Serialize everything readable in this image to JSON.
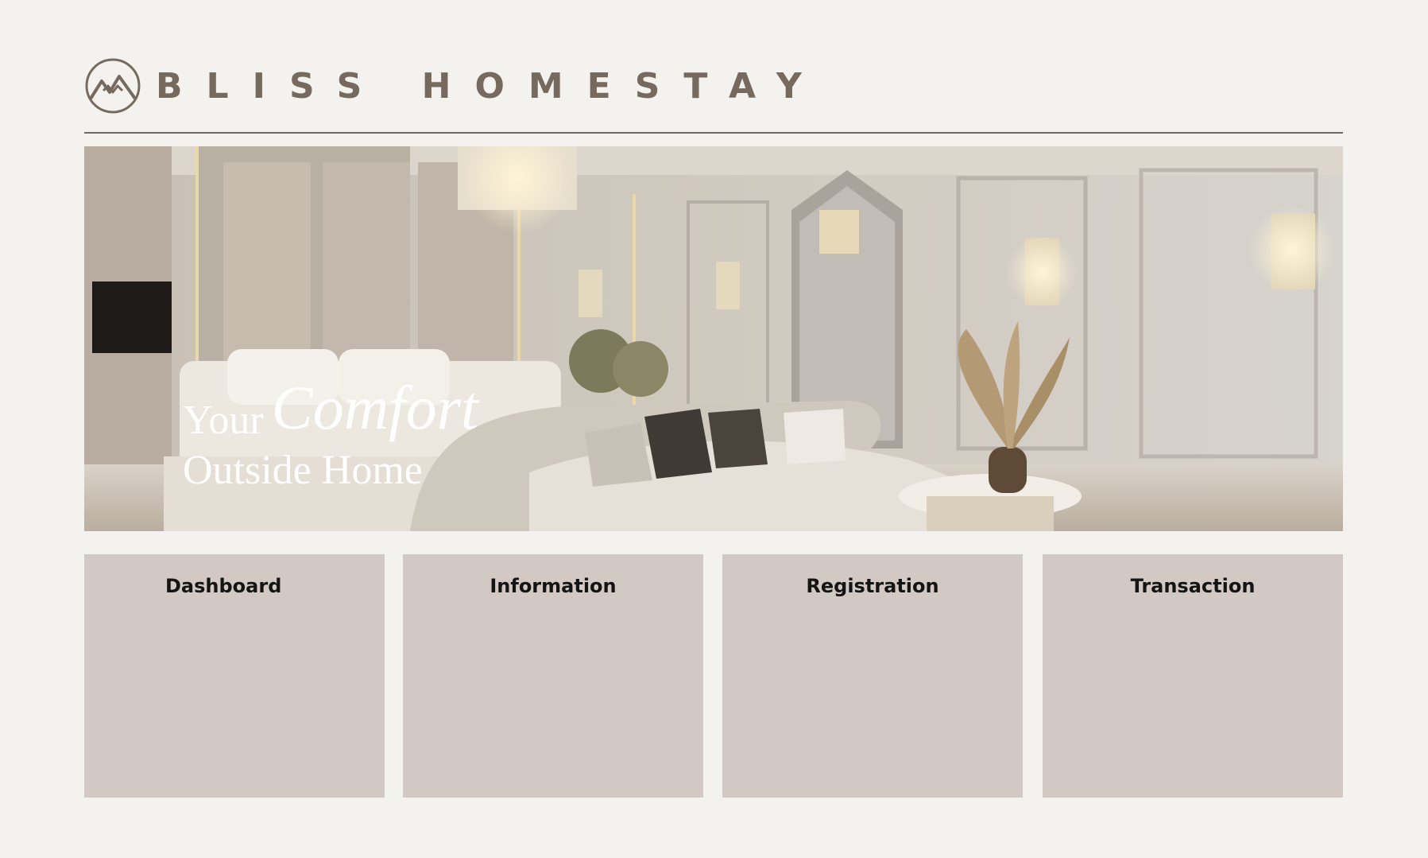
{
  "brand": {
    "name": "BLISS HOMESTAY",
    "logo_icon": "mountain-circle-icon",
    "color": "#756a5d"
  },
  "hero": {
    "image": "luxury-bedroom-photo",
    "tagline_word1": "Your",
    "tagline_word2": "Comfort",
    "tagline_line2": "Outside Home"
  },
  "nav_cards": [
    {
      "label": "Dashboard"
    },
    {
      "label": "Information"
    },
    {
      "label": "Registration"
    },
    {
      "label": "Transaction"
    }
  ],
  "colors": {
    "background": "#f4f2ef",
    "card": "#d2c9c4",
    "rule": "#6f6a66"
  }
}
